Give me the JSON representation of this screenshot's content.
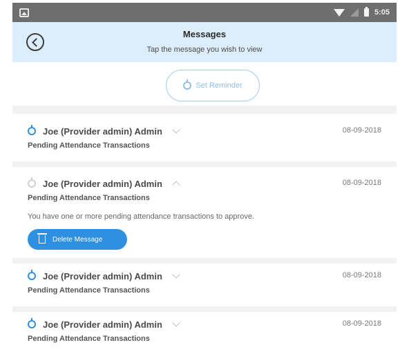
{
  "status_bar": {
    "time": "5:05"
  },
  "header": {
    "title": "Messages",
    "subtitle": "Tap the message you wish to view"
  },
  "reminder": {
    "label": "Set Reminder"
  },
  "messages": [
    {
      "sender": "Joe (Provider admin) Admin",
      "date": "08-09-2018",
      "subject": "Pending Attendance Transactions",
      "expanded": false
    },
    {
      "sender": "Joe (Provider admin) Admin",
      "date": "08-09-2018",
      "subject": "Pending Attendance Transactions",
      "body": "You have one or more pending attendance transactions to approve.",
      "delete_label": "Delete Message",
      "expanded": true
    },
    {
      "sender": "Joe (Provider admin) Admin",
      "date": "08-09-2018",
      "subject": "Pending Attendance Transactions",
      "expanded": false
    },
    {
      "sender": "Joe (Provider admin) Admin",
      "date": "08-09-2018",
      "subject": "Pending Attendance Transactions",
      "expanded": false
    }
  ],
  "colors": {
    "accent": "#2f8fe0",
    "header_bg": "#dcedfb",
    "status_bar": "#6e6e6e"
  }
}
